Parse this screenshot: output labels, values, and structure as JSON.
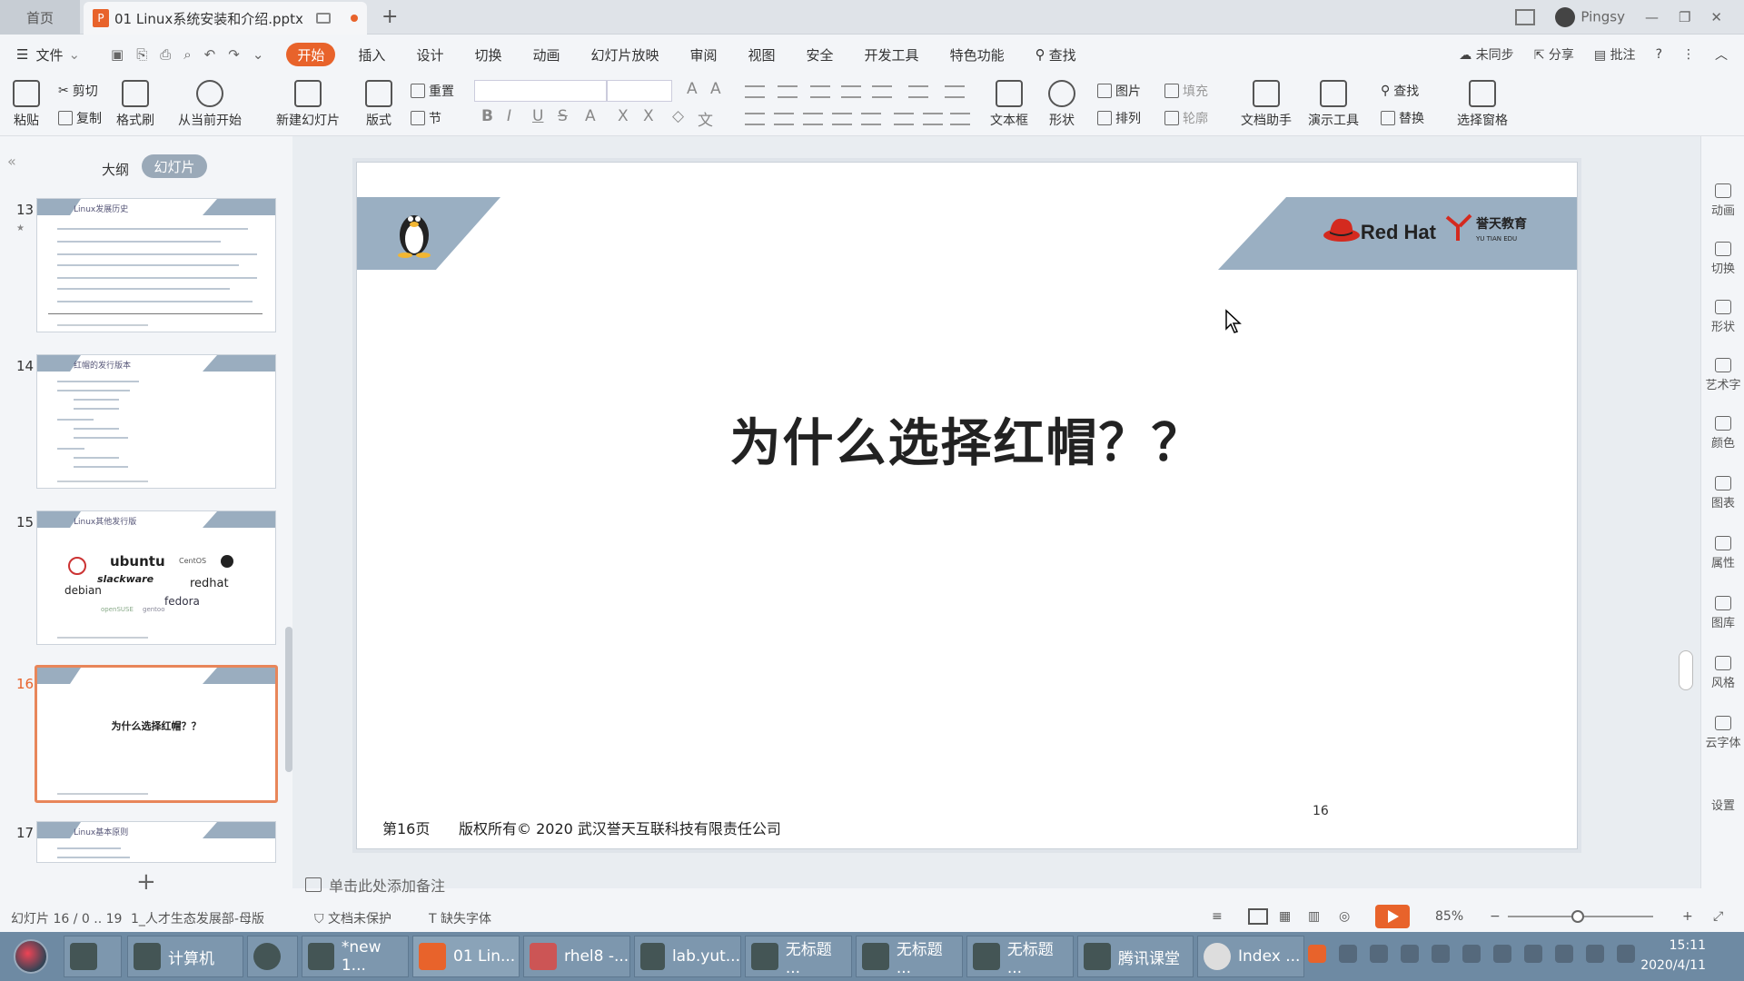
{
  "titlebar": {
    "home_tab": "首页",
    "doc_tab": "01 Linux系统安装和介绍.pptx",
    "user": "Pingsy"
  },
  "menu": {
    "file": "文件",
    "items": [
      "开始",
      "插入",
      "设计",
      "切换",
      "动画",
      "幻灯片放映",
      "审阅",
      "视图",
      "安全",
      "开发工具",
      "特色功能"
    ],
    "search": "查找",
    "sync": "未同步",
    "share": "分享",
    "comment": "批注"
  },
  "ribbon": {
    "paste": "粘贴",
    "cut": "剪切",
    "copy": "复制",
    "format_painter": "格式刷",
    "from_current": "从当前开始",
    "new_slide": "新建幻灯片",
    "layout": "版式",
    "reset": "重置",
    "section": "节",
    "textbox": "文本框",
    "shape": "形状",
    "picture": "图片",
    "fill": "填充",
    "arrange": "排列",
    "outline": "轮廓",
    "doc_helper": "文档助手",
    "present_tools": "演示工具",
    "find": "查找",
    "replace": "替换",
    "selection_pane": "选择窗格"
  },
  "panel": {
    "outline_tab": "大纲",
    "slides_tab": "幻灯片",
    "thumbs": [
      {
        "num": "13",
        "title": "Linux发展历史"
      },
      {
        "num": "14",
        "title": "红帽的发行版本"
      },
      {
        "num": "15",
        "title": "Linux其他发行版"
      },
      {
        "num": "16",
        "title": "为什么选择红帽？？"
      },
      {
        "num": "17",
        "title": "Linux基本原则"
      }
    ],
    "distro_logos": [
      "ubuntu",
      "slackware",
      "debian",
      "redhat",
      "fedora",
      "CentOS",
      "openSUSE",
      "gentoo"
    ]
  },
  "slide": {
    "title": "为什么选择红帽？？",
    "page_label": "第16页",
    "copyright": "版权所有© 2020 武汉誉天互联科技有限责任公司",
    "number": "16",
    "brand_redhat": "Red Hat",
    "brand_yutian": "誉天教育",
    "brand_yutian_en": "YU TIAN EDU",
    "notes_placeholder": "单击此处添加备注"
  },
  "rightbar": [
    "动画",
    "切换",
    "形状",
    "艺术字",
    "颜色",
    "图表",
    "属性",
    "图库",
    "风格",
    "云字体",
    "设置"
  ],
  "status": {
    "slide_pos": "幻灯片 16 / 0 .. 19",
    "theme": "1_人才生态发展部-母版",
    "protect": "文档未保护",
    "missing_font": "缺失字体",
    "zoom": "85%"
  },
  "taskbar": {
    "items": [
      "计算机",
      "*new 1...",
      "01 Lin...",
      "rhel8 -...",
      "lab.yut...",
      "无标题 ...",
      "无标题 ...",
      "无标题 ...",
      "腾讯课堂",
      "Index ..."
    ],
    "time": "15:11",
    "date": "2020/4/11"
  },
  "colors": {
    "accent": "#e8632b",
    "header_band": "#9aafc2",
    "taskbar": "#6e8aa3"
  }
}
